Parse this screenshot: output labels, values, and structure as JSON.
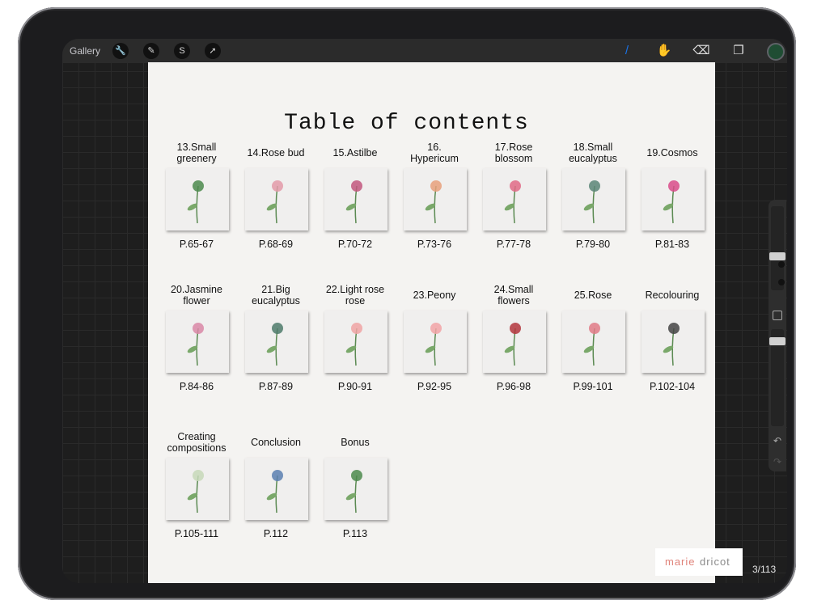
{
  "toolbar": {
    "gallery_label": "Gallery",
    "left_tools": [
      {
        "name": "actions-wrench-icon",
        "glyph": "🔧"
      },
      {
        "name": "adjustments-wand-icon",
        "glyph": "✎"
      },
      {
        "name": "selection-icon",
        "glyph": "S"
      },
      {
        "name": "transform-arrow-icon",
        "glyph": "➚"
      }
    ],
    "right_tools": [
      {
        "name": "brush-icon",
        "glyph": "/",
        "color": "#1a73e8"
      },
      {
        "name": "smudge-icon",
        "glyph": "✋",
        "color": "#e0e0e0"
      },
      {
        "name": "eraser-icon",
        "glyph": "⌫",
        "color": "#e0e0e0"
      },
      {
        "name": "layers-icon",
        "glyph": "❐",
        "color": "#e0e0e0"
      }
    ],
    "active_color": "#1f4d33"
  },
  "document": {
    "title": "Table of contents",
    "rows": [
      [
        {
          "label": "13.Small\ngreenery",
          "pages": "P.65-67"
        },
        {
          "label": "14.Rose bud",
          "pages": "P.68-69"
        },
        {
          "label": "15.Astilbe",
          "pages": "P.70-72"
        },
        {
          "label": "16.\nHypericum",
          "pages": "P.73-76"
        },
        {
          "label": "17.Rose\nblossom",
          "pages": "P.77-78"
        },
        {
          "label": "18.Small\neucalyptus",
          "pages": "P.79-80"
        },
        {
          "label": "19.Cosmos",
          "pages": "P.81-83"
        }
      ],
      [
        {
          "label": "20.Jasmine\nflower",
          "pages": "P.84-86"
        },
        {
          "label": "21.Big\neucalyptus",
          "pages": "P.87-89"
        },
        {
          "label": "22.Light rose\nrose",
          "pages": "P.90-91"
        },
        {
          "label": "23.Peony",
          "pages": "P.92-95"
        },
        {
          "label": "24.Small\nflowers",
          "pages": "P.96-98"
        },
        {
          "label": "25.Rose",
          "pages": "P.99-101"
        },
        {
          "label": "Recolouring",
          "pages": "P.102-104"
        }
      ],
      [
        {
          "label": "Creating\ncompositions",
          "pages": "P.105-111"
        },
        {
          "label": "Conclusion",
          "pages": "P.112"
        },
        {
          "label": "Bonus",
          "pages": "P.113"
        }
      ]
    ]
  },
  "brand": {
    "part1": "marie",
    "part2": "dricot"
  },
  "page_counter": "3/113",
  "sidebar": {
    "undo_glyph": "↶",
    "redo_glyph": "↷"
  }
}
